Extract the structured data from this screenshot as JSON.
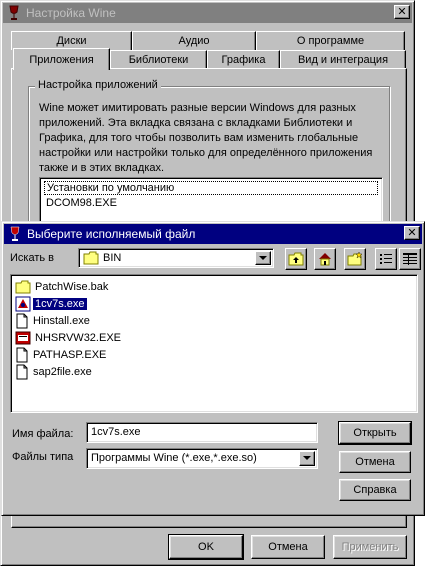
{
  "settings_window": {
    "title": "Настройка Wine",
    "tabs_row1": [
      "Диски",
      "Аудио",
      "О программе"
    ],
    "tabs_row2": [
      "Приложения",
      "Библиотеки",
      "Графика",
      "Вид и интеграция"
    ],
    "selected_tab": "Приложения",
    "group_label": "Настройка приложений",
    "description": "Wine может имитировать разные версии Windows для разных приложений. Эта вкладка связана с вкладками Библиотеки и Графика, для того чтобы позволить вам изменить глобальные настройки или настройки только для определённого приложения также и в этих вкладках.",
    "app_list": [
      "Установки по умолчанию",
      "DCOM98.EXE"
    ],
    "buttons": {
      "ok": "OK",
      "cancel": "Отмена",
      "apply": "Применить"
    }
  },
  "file_dialog": {
    "title": "Выберите исполняемый файл",
    "look_in_label": "Искать в",
    "look_in_hotkey": "в",
    "look_in_value": "BIN",
    "files": [
      {
        "name": "PatchWise.bak",
        "icon": "folder-icon"
      },
      {
        "name": "1cv7s.exe",
        "icon": "app-exe-icon",
        "selected": true
      },
      {
        "name": "Hinstall.exe",
        "icon": "file-icon"
      },
      {
        "name": "NHSRVW32.EXE",
        "icon": "red-app-icon"
      },
      {
        "name": "PATHASP.EXE",
        "icon": "file-icon"
      },
      {
        "name": "sap2file.exe",
        "icon": "file-icon"
      }
    ],
    "filename_label": "Имя файла:",
    "filename_value": "1cv7s.exe",
    "filetype_label": "Файлы типа",
    "filetype_value": "Программы Wine (*.exe,*.exe.so)",
    "buttons": {
      "open": "Открыть",
      "cancel": "Отмена",
      "help": "Справка"
    }
  },
  "colors": {
    "active_title": "#000080",
    "inactive_title": "#808080",
    "face": "#c0c0c0",
    "selection": "#000080"
  }
}
